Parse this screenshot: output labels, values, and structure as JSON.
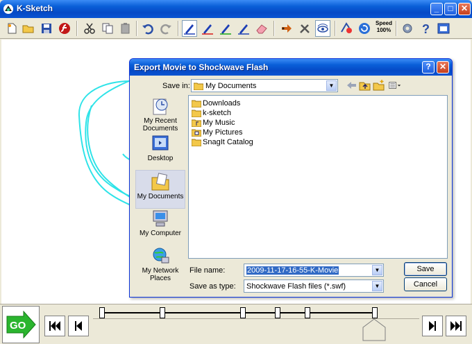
{
  "app": {
    "title": "K-Sketch"
  },
  "toolbar": {
    "speed_label": "Speed",
    "speed_value": "100%"
  },
  "dialog": {
    "title": "Export Movie to Shockwave Flash",
    "save_in_label": "Save in:",
    "save_in_value": "My Documents",
    "places": [
      {
        "label": "My Recent Documents",
        "icon": "recent-documents-icon"
      },
      {
        "label": "Desktop",
        "icon": "desktop-icon"
      },
      {
        "label": "My Documents",
        "icon": "my-documents-icon"
      },
      {
        "label": "My Computer",
        "icon": "my-computer-icon"
      },
      {
        "label": "My Network Places",
        "icon": "network-places-icon"
      }
    ],
    "files": [
      {
        "name": "Downloads"
      },
      {
        "name": "k-sketch"
      },
      {
        "name": "My Music"
      },
      {
        "name": "My Pictures"
      },
      {
        "name": "SnagIt Catalog"
      }
    ],
    "file_name_label": "File name:",
    "file_name_value": "2009-11-17-16-55-K-Movie",
    "save_type_label": "Save as type:",
    "save_type_value": "Shockwave Flash files (*.swf)",
    "save_button": "Save",
    "cancel_button": "Cancel"
  },
  "timeline": {
    "go_label": "GO"
  },
  "colors": {
    "titlebar": "#0a5fd8",
    "sketch_stroke": "#2ee3e8",
    "go_green": "#2ab52e"
  }
}
